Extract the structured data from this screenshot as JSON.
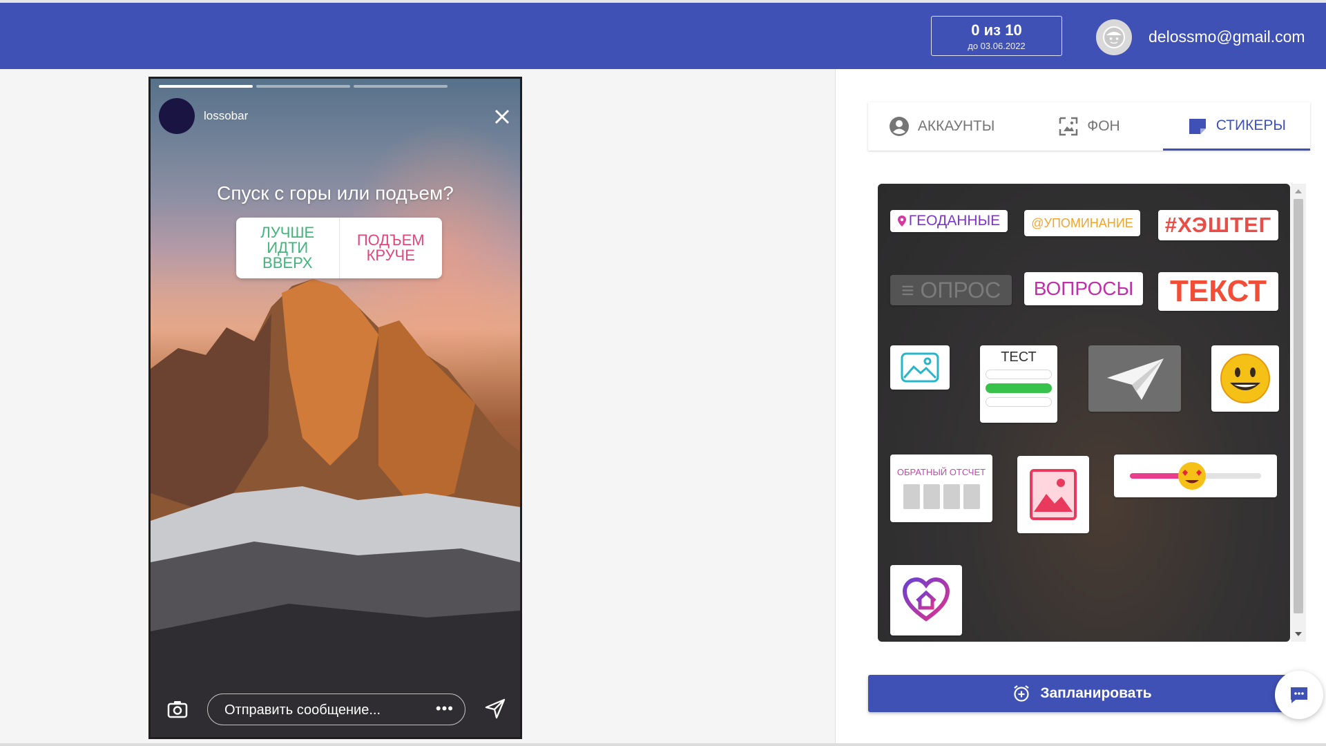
{
  "header": {
    "quota_main": "0 из 10",
    "quota_sub": "до 03.06.2022",
    "email": "delossmo@gmail.com",
    "bg_color": "#3f51b5"
  },
  "story": {
    "username": "lossobar",
    "question": "Спуск с горы или подъем?",
    "poll_option_a": "ЛУЧШЕ\nИДТИ\nВВЕРХ",
    "poll_option_b": "ПОДЪЕМ\nКРУЧЕ",
    "message_placeholder": "Отправить сообщение...",
    "more_label": "•••"
  },
  "tabs": [
    {
      "label": "АККАУНТЫ",
      "icon": "account-circle-icon",
      "active": false
    },
    {
      "label": "ФОН",
      "icon": "background-image-icon",
      "active": false
    },
    {
      "label": "СТИКЕРЫ",
      "icon": "sticker-icon",
      "active": true
    }
  ],
  "stickers": {
    "geo": "ГЕОДАННЫЕ",
    "mention": "@УПОМИНАНИЕ",
    "hashtag": "#ХЭШТЕГ",
    "poll": "≡ ОПРОС",
    "questions": "ВОПРОСЫ",
    "text": "ТЕКСТ",
    "quiz": "ТЕСТ",
    "countdown": "ОБРАТНЫЙ ОТСЧЕТ"
  },
  "actions": {
    "schedule_label": "Запланировать"
  },
  "colors": {
    "accent": "#3f51b5",
    "quiz_green": "#38c24b",
    "poll_green": "#3fb57a",
    "poll_pink": "#e0457b"
  }
}
